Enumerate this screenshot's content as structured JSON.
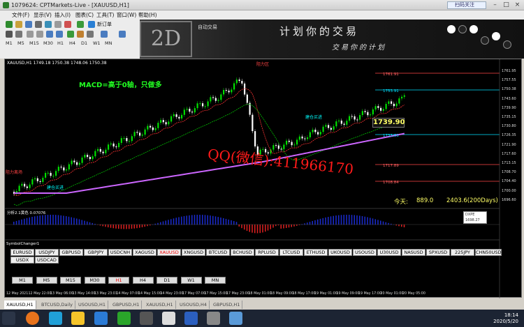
{
  "window": {
    "title": "1079624: CPTMarkets-Live - [XAUUSD,H1]",
    "ad_label": "扫码关注"
  },
  "menu": [
    "文件(F)",
    "显示(V)",
    "插入(I)",
    "图表(C)",
    "工具(T)",
    "窗口(W)",
    "帮助(H)"
  ],
  "toolbar": {
    "new_order": "新订单",
    "algo_trading": "自动交易",
    "timeframes": [
      "M1",
      "M5",
      "M15",
      "M30",
      "H1",
      "H4",
      "D1",
      "W1",
      "MN"
    ]
  },
  "banner": {
    "logo_text": "2D",
    "line1": "计划你的交易",
    "line2": "交易你的计划"
  },
  "chart": {
    "header": "XAUUSD,H1  1749.18 1750.38 1748.06 1750.38",
    "macd_note": "MACD=高于0轴，只做多",
    "qq_watermark": "QQ(微信):411966170",
    "current_price_box": "1739.90",
    "today_label": "今天:",
    "today_value": "889.0",
    "today_range": "2403.6(200Days)",
    "labels": {
      "red_top": "阻力区",
      "green1": "建仓买进",
      "green2": "建仓买进",
      "red_left": "阻力离场"
    },
    "indicator_header": "分析2.1黄色  0.07076",
    "dxpe_label": "DXPE",
    "dxpe_value": "1698.27"
  },
  "price_axis": [
    "1761.95",
    "1757.55",
    "1750.38",
    "1743.60",
    "1739.90",
    "1735.15",
    "1730.80",
    "1726.35",
    "1721.90",
    "1717.60",
    "1713.15",
    "1708.70",
    "1704.40",
    "1700.00",
    "1696.60"
  ],
  "price_levels": [
    {
      "label": "1761.91",
      "color": "#ff4444"
    },
    {
      "label": "1753.91",
      "color": "#00e0ff"
    },
    {
      "label": "1733.63",
      "color": "#00e0ff"
    },
    {
      "label": "1717.89",
      "color": "#ff4444"
    },
    {
      "label": "1708.84",
      "color": "#ff4444"
    }
  ],
  "time_axis": [
    "12 May 2021",
    "12 May 22:00",
    "13 May 06:00",
    "13 May 14:00",
    "13 May 23:01",
    "14 May 07:00",
    "14 May 15:00",
    "14 May 23:00",
    "17 May 07:00",
    "17 May 15:00",
    "17 May 23:00",
    "18 May 01:00",
    "18 May 09:00",
    "18 May 17:00",
    "19 May 01:00",
    "19 May 09:00",
    "19 May 17:00",
    "20 May 01:00",
    "20 May 05:00"
  ],
  "symbol_changer": {
    "title": "SymbolChanger1",
    "symbols": [
      "EURUSD",
      "USDJPY",
      "GBPUSD",
      "GBPJPY",
      "USDCNH",
      "XAGUSD",
      "XAUUSD",
      "XNGUSD",
      "BTCUSD",
      "BCHUSD",
      "RPLUSD",
      "LTCUSD",
      "ETHUSD",
      "UKOUSD",
      "USOUSD",
      "U30USD",
      "NASUSD",
      "SPXUSD",
      "225JPY",
      "CHN50USD",
      "USDX",
      "USDCAD"
    ],
    "active_symbol": "XAUUSD",
    "timeframes": [
      "M1",
      "M5",
      "M15",
      "M30",
      "H1",
      "H4",
      "D1",
      "W1",
      "MN"
    ],
    "active_timeframe": "H1"
  },
  "tabs": [
    "XAUUSD,H1",
    "BTCUSD,Daily",
    "USOUSD,H1",
    "GBPUSD,H1",
    "XAUUSD,H1",
    "USOUSD,H4",
    "GBPUSD,H1"
  ],
  "clock": {
    "time": "18:14",
    "date": "2020/5/20"
  },
  "colors": {
    "up": "#00e000",
    "down": "#ffffff",
    "ma_red": "#ff3333",
    "ma_green": "#00c000",
    "ma_purple": "#cc66ff",
    "macd_blue": "#1a2bd0",
    "macd_red": "#e02020"
  }
}
